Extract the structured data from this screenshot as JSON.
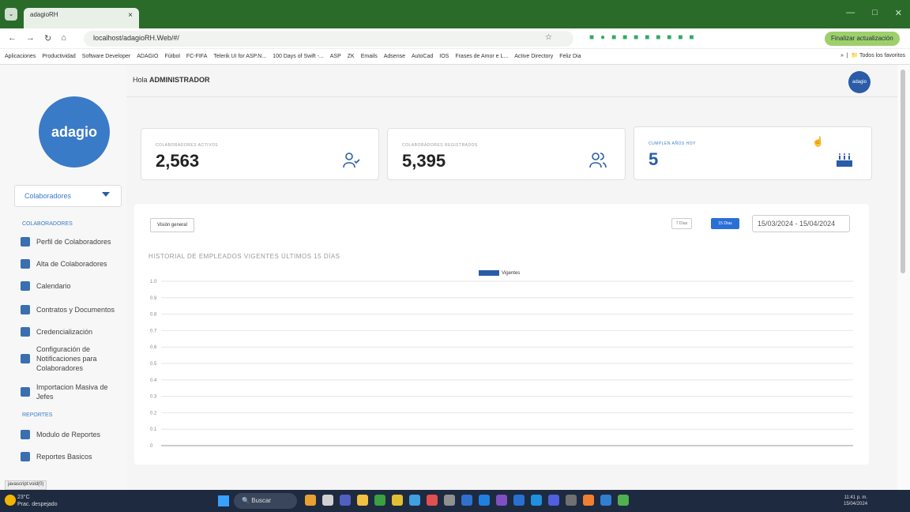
{
  "browser": {
    "tab_title": "adagioRH",
    "tab_close": "×",
    "url": "localhost/adagioRH.Web/#/",
    "update_button": "Finalizar actualización",
    "window_controls": {
      "minimize": "—",
      "maximize": "□",
      "close": "✕"
    }
  },
  "bookmarks": [
    "Aplicaciones",
    "Productividad",
    "Software Developer",
    "ADAGIO",
    "Fútbol",
    "FC-FIFA",
    "Telerik UI for ASP.N...",
    "100 Days of Swift -...",
    "ASP",
    "ZK",
    "Emails",
    "Adsense",
    "AutoCad",
    "IOS",
    "Frases de Amor e L...",
    "Active Directory",
    "Feliz Dia"
  ],
  "bookmarks_more": "»",
  "bookmarks_all": "Todos los favoritos",
  "sidebar": {
    "logo_text": "adagio",
    "selector_label": "Colaboradores",
    "section1": "COLABORADORES",
    "items": [
      {
        "label": "Perfil de Colaboradores"
      },
      {
        "label": "Alta de Colaboradores"
      },
      {
        "label": "Calendario"
      },
      {
        "label": "Contratos y Documentos"
      },
      {
        "label": "Credencialización"
      },
      {
        "label": "Configuración de Notificaciones para Colaboradores"
      },
      {
        "label": "Importacion Masiva de Jefes"
      }
    ],
    "section2": "REPORTES",
    "reports": [
      {
        "label": "Modulo de Reportes"
      },
      {
        "label": "Reportes Basicos"
      }
    ]
  },
  "header": {
    "greeting": "Hola",
    "user": "ADMINISTRADOR",
    "avatar_text": "adagio"
  },
  "cards": [
    {
      "label": "COLABORADORES ACTIVOS",
      "value": "2,563",
      "icon": "user-check-icon"
    },
    {
      "label": "COLABORADORES REGISTRADOS",
      "value": "5,395",
      "icon": "users-icon"
    },
    {
      "label": "CUMPLEN AÑOS HOY",
      "value": "5",
      "icon": "cake-icon"
    }
  ],
  "panel": {
    "tab_label": "Visión general",
    "btn_7": "7 Días",
    "btn_15": "15 Días",
    "date_range": "15/03/2024 - 15/04/2024"
  },
  "chart_data": {
    "type": "bar",
    "title": "HISTORIAL DE EMPLEADOS VIGENTES ÚLTIMOS 15 DÍAS",
    "series": [
      {
        "name": "Vigentes",
        "values": []
      }
    ],
    "categories": [],
    "ylim": [
      0,
      1.0
    ],
    "yticks": [
      "1.0",
      "0.9",
      "0.8",
      "0.7",
      "0.6",
      "0.5",
      "0.4",
      "0.3",
      "0.2",
      "0.1",
      "0"
    ],
    "grid": true,
    "legend": "top-center",
    "color": "#2a5ca8"
  },
  "status_bar": "javascript:void(0)",
  "taskbar": {
    "temp": "23°C",
    "weather": "Prac. despejado",
    "search": "Buscar",
    "time": "11:41 p. m.",
    "date": "15/04/2024"
  }
}
